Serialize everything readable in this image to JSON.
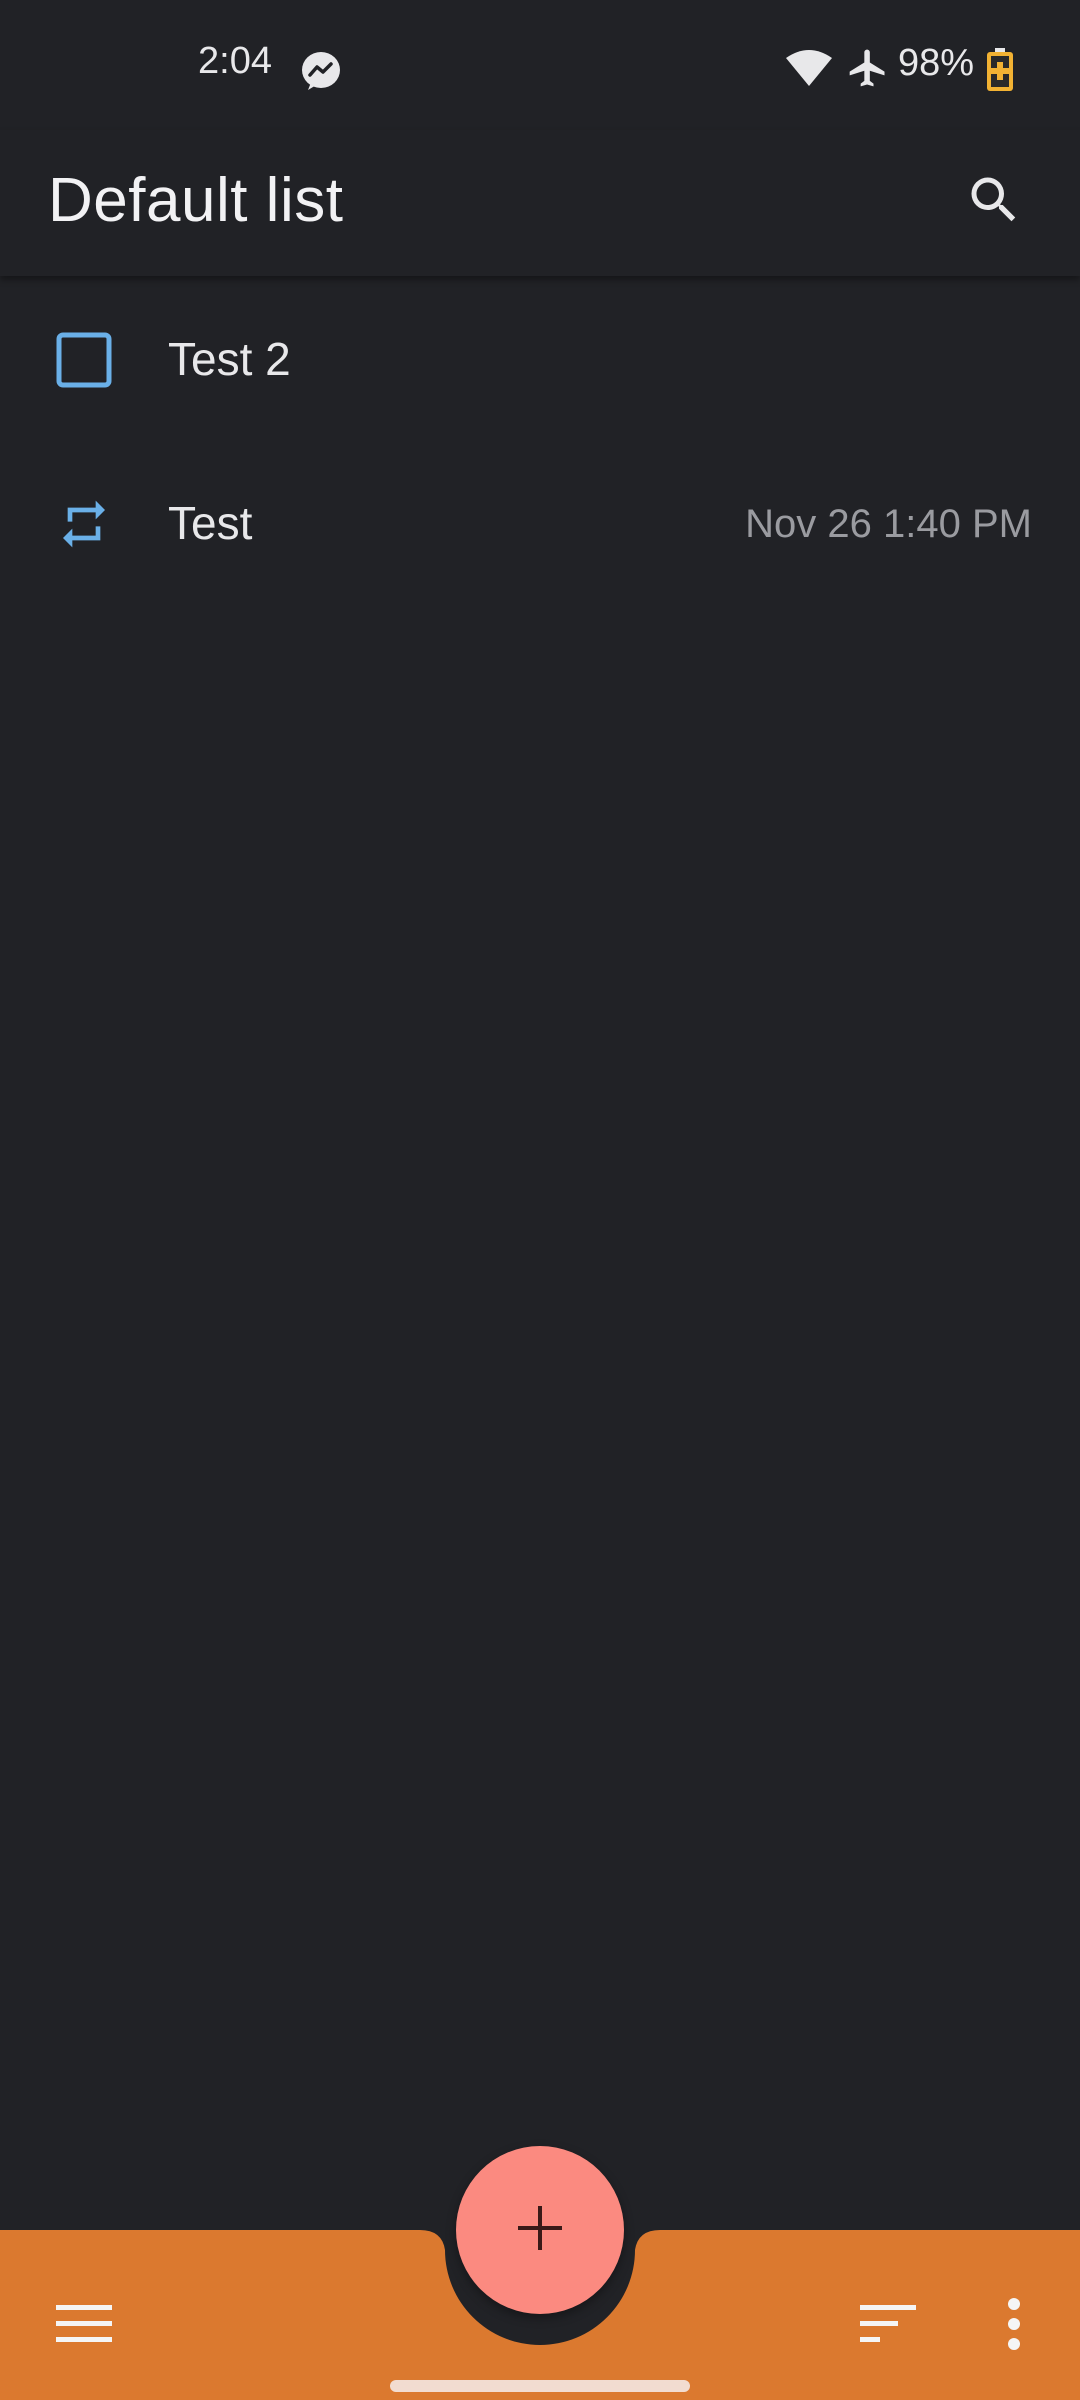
{
  "status_bar": {
    "time": "2:04",
    "battery_text": "98%",
    "icons": [
      "messenger-icon",
      "wifi-icon",
      "airplane-icon",
      "battery-charging-icon"
    ]
  },
  "app_bar": {
    "title": "Default list",
    "search_icon": "search-icon"
  },
  "tasks": [
    {
      "title": "Test 2",
      "icon": "checkbox-unchecked-icon",
      "date": ""
    },
    {
      "title": "Test",
      "icon": "repeat-icon",
      "date": "Nov 26 1:40 PM"
    }
  ],
  "bottom_bar": {
    "menu_icon": "menu-icon",
    "sort_icon": "sort-icon",
    "more_icon": "more-vert-icon",
    "fab_icon": "plus-icon"
  },
  "colors": {
    "background": "#212226",
    "accent_blue": "#6ab0e8",
    "bottom_bar": "#db792f",
    "fab": "#fb8a80",
    "text_primary": "#e8e8ea",
    "text_secondary": "#9a9ba0"
  }
}
